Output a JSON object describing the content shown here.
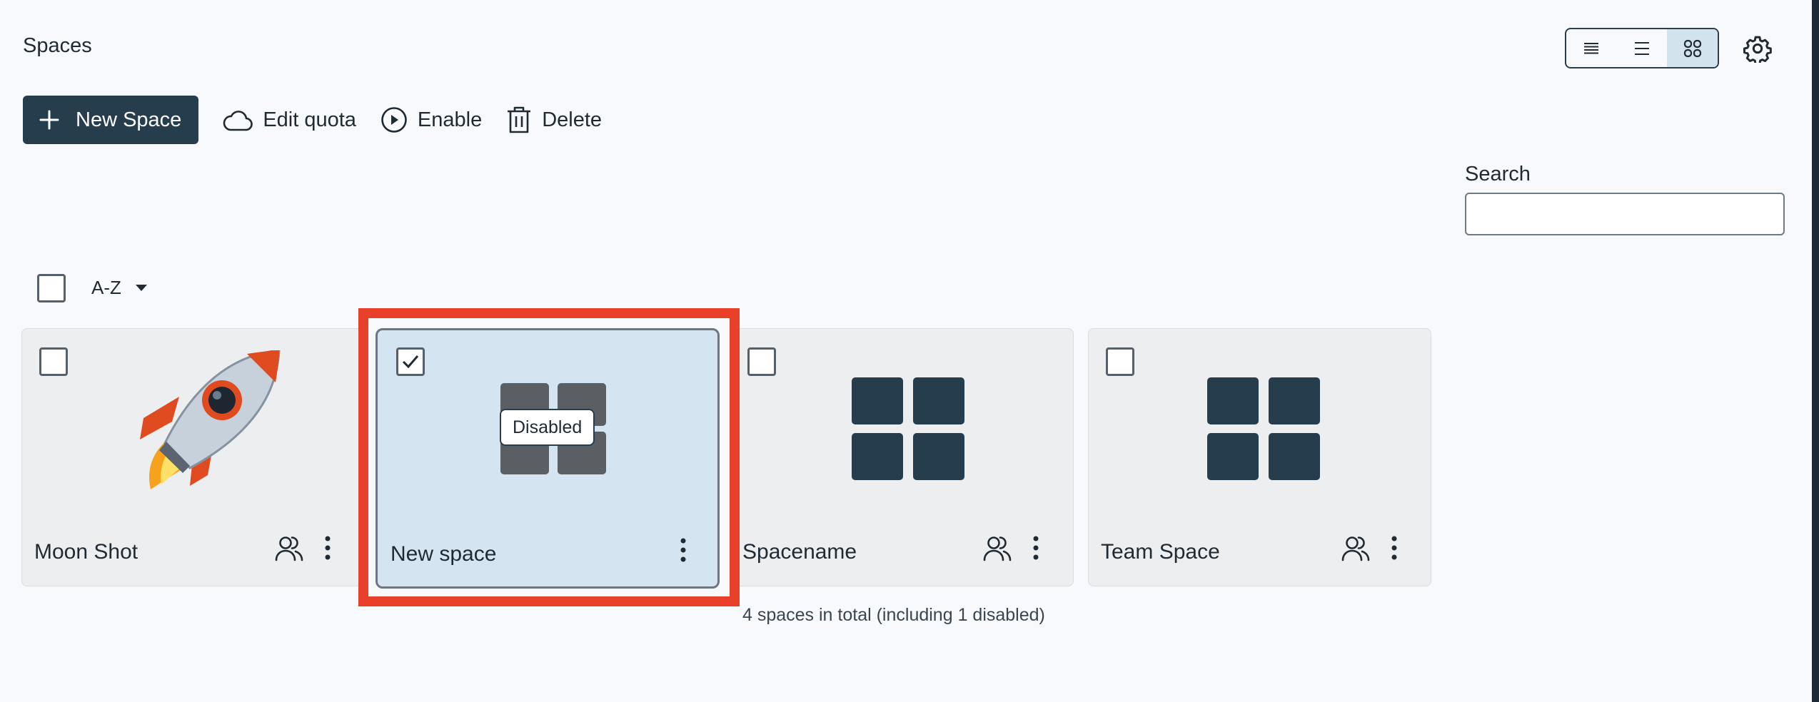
{
  "page": {
    "title": "Spaces"
  },
  "view_toggle": {
    "options": [
      {
        "name": "condensed-table",
        "icon": "condensed-list-icon",
        "active": false
      },
      {
        "name": "table",
        "icon": "list-icon",
        "active": false
      },
      {
        "name": "tiles",
        "icon": "tiles-grid-icon",
        "active": true
      }
    ]
  },
  "toolbar": {
    "new_space_label": "New Space",
    "edit_quota_label": "Edit quota",
    "enable_label": "Enable",
    "delete_label": "Delete"
  },
  "search": {
    "label": "Search",
    "value": "",
    "placeholder": ""
  },
  "sort": {
    "label": "A-Z"
  },
  "spaces": [
    {
      "name": "Moon Shot",
      "image": "rocket-emoji",
      "checked": false,
      "disabled": false
    },
    {
      "name": "New space",
      "image": "space-grid-icon",
      "checked": true,
      "disabled": true,
      "badge": "Disabled"
    },
    {
      "name": "Spacename",
      "image": "space-grid-icon",
      "checked": false,
      "disabled": false
    },
    {
      "name": "Team Space",
      "image": "space-grid-icon",
      "checked": false,
      "disabled": false
    }
  ],
  "footer": {
    "summary": "4 spaces in total (including 1 disabled)"
  },
  "colors": {
    "primary": "#263d4d",
    "highlight": "#e8402a",
    "selected_card": "#d4e4f0",
    "tile_icon": "#263d4d",
    "disabled_icon": "#5b5f63"
  }
}
